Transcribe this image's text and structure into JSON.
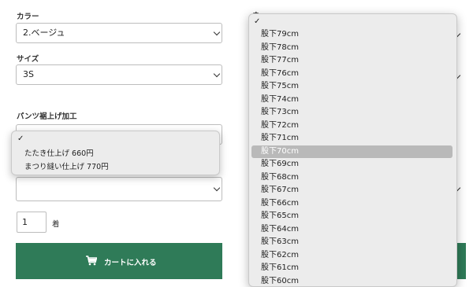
{
  "form": {
    "color_label": "カラー",
    "color_value": "2.ベージュ",
    "size_label": "サイズ",
    "size_value": "3S",
    "hem_label": "パンツ裾上げ加工",
    "hem_value": "",
    "extra_value": "",
    "quantity": "1",
    "quantity_unit": "着",
    "cart_button": "カートに入れる",
    "right_label_fragment": "ネ"
  },
  "hem_popup": {
    "check": "✓",
    "options": [
      "たたき仕上げ 660円",
      "まつり縫い仕上げ 770円"
    ]
  },
  "inseam_popup": {
    "check": "✓",
    "selected_index": 9,
    "options": [
      "股下79cm",
      "股下78cm",
      "股下77cm",
      "股下76cm",
      "股下75cm",
      "股下74cm",
      "股下73cm",
      "股下72cm",
      "股下71cm",
      "股下70cm",
      "股下69cm",
      "股下68cm",
      "股下67cm",
      "股下66cm",
      "股下65cm",
      "股下64cm",
      "股下63cm",
      "股下62cm",
      "股下61cm",
      "股下60cm"
    ]
  },
  "colors": {
    "cart_bg": "#2f7b58",
    "popup_bg": "#ececec",
    "highlight": "#b9b9b9"
  }
}
